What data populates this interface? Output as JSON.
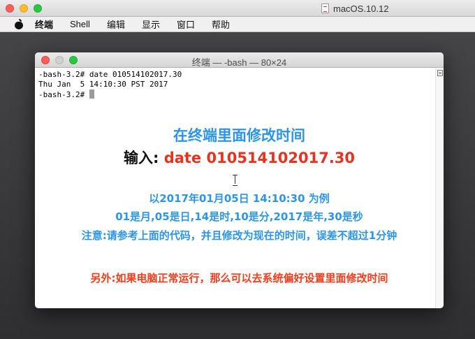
{
  "host": {
    "title": "macOS.10.12"
  },
  "menubar": {
    "items": [
      "终端",
      "Shell",
      "编辑",
      "显示",
      "窗口",
      "帮助"
    ]
  },
  "terminal": {
    "title": "终端 — -bash — 80×24",
    "lines": [
      "-bash-3.2# date 010514102017.30",
      "Thu Jan  5 14:10:30 PST 2017",
      "-bash-3.2# "
    ]
  },
  "annotations": {
    "heading": "在终端里面修改时间",
    "input_label": "输入: ",
    "input_command": "date 010514102017.30",
    "example": "以2017年01月05日 14:10:30 为例",
    "explanation": "01是月,05是日,14是时,10是分,2017是年,30是秒",
    "note": "注意:请参考上面的代码，并且修改为现在的时间，误差不超过1分钟",
    "extra": "另外:如果电脑正常运行，那么可以去系统偏好设置里面修改时间"
  },
  "colors": {
    "accent_blue": "#2d95e8",
    "accent_red": "#e8321e",
    "extra_red": "#ff3a1a"
  }
}
